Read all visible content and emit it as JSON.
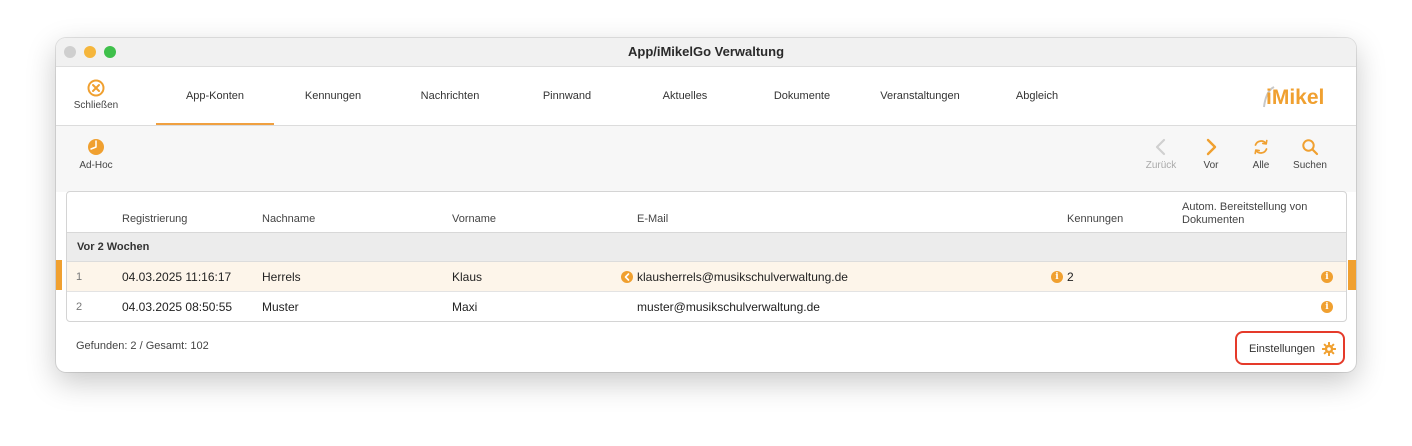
{
  "window": {
    "title": "App/iMikelGo Verwaltung"
  },
  "header": {
    "close_label": "Schließen",
    "logo_text": "iMikel",
    "tabs": [
      {
        "label": "App-Konten",
        "active": true
      },
      {
        "label": "Kennungen",
        "active": false
      },
      {
        "label": "Nachrichten",
        "active": false
      },
      {
        "label": "Pinnwand",
        "active": false
      },
      {
        "label": "Aktuelles",
        "active": false
      },
      {
        "label": "Dokumente",
        "active": false
      },
      {
        "label": "Veranstaltungen",
        "active": false
      },
      {
        "label": "Abgleich",
        "active": false
      }
    ]
  },
  "toolbar": {
    "adhoc_label": "Ad-Hoc",
    "back_label": "Zurück",
    "forward_label": "Vor",
    "all_label": "Alle",
    "search_label": "Suchen"
  },
  "table": {
    "columns": {
      "registration": "Registrierung",
      "lastname": "Nachname",
      "firstname": "Vorname",
      "email": "E-Mail",
      "ids": "Kennungen",
      "auto_docs": "Autom. Bereitstellung von Dokumenten"
    },
    "group_label": "Vor 2 Wochen",
    "rows": [
      {
        "num": "1",
        "registration": "04.03.2025 11:16:17",
        "lastname": "Herrels",
        "firstname": "Klaus",
        "email": "klausherrels@musikschulverwaltung.de",
        "ids": "2",
        "selected": true
      },
      {
        "num": "2",
        "registration": "04.03.2025 08:50:55",
        "lastname": "Muster",
        "firstname": "Maxi",
        "email": "muster@musikschulverwaltung.de",
        "ids": "",
        "selected": false
      }
    ]
  },
  "footer": {
    "status": "Gefunden: 2 / Gesamt: 102",
    "settings_label": "Einstellungen"
  },
  "colors": {
    "accent": "#f0a030",
    "highlight": "#e53a2a",
    "selected_row": "#fdf5ea"
  }
}
